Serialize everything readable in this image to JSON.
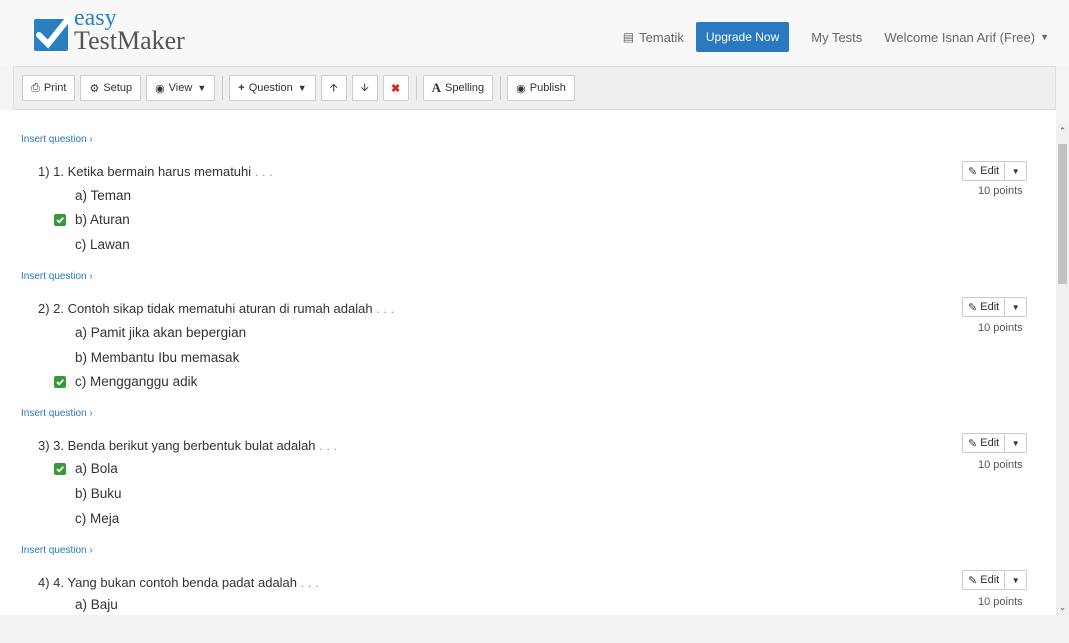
{
  "header": {
    "logo_easy": "easy",
    "logo_testmaker": "TestMaker",
    "tematik": "Tematik",
    "upgrade": "Upgrade Now",
    "my_tests": "My Tests",
    "welcome": "Welcome Isnan Arif (Free)"
  },
  "toolbar": {
    "print": "Print",
    "setup": "Setup",
    "view": "View",
    "question": "Question",
    "spelling": "Spelling",
    "publish": "Publish"
  },
  "insert_label": "Insert question",
  "edit_label": "Edit",
  "questions": [
    {
      "text": "1) 1. Ketika bermain harus mematuhi",
      "dots": ". . .",
      "points": "10 points",
      "options": [
        {
          "label": "a) Teman",
          "correct": false
        },
        {
          "label": "b) Aturan",
          "correct": true
        },
        {
          "label": "c) Lawan",
          "correct": false
        }
      ]
    },
    {
      "text": "2) 2. Contoh sikap tidak mematuhi aturan di rumah adalah",
      "dots": ". . .",
      "points": "10 points",
      "options": [
        {
          "label": "a) Pamit jika akan bepergian",
          "correct": false
        },
        {
          "label": "b) Membantu Ibu memasak",
          "correct": false
        },
        {
          "label": "c) Mengganggu adik",
          "correct": true
        }
      ]
    },
    {
      "text": "3) 3. Benda berikut yang berbentuk bulat adalah",
      "dots": ". . .",
      "points": "10 points",
      "options": [
        {
          "label": "a) Bola",
          "correct": true
        },
        {
          "label": "b) Buku",
          "correct": false
        },
        {
          "label": "c) Meja",
          "correct": false
        }
      ]
    },
    {
      "text": "4) 4. Yang bukan contoh benda padat adalah",
      "dots": ". . .",
      "points": "10 points",
      "options": [
        {
          "label": "a) Baju",
          "correct": false
        }
      ]
    }
  ],
  "colors": {
    "accent": "#2a78bf",
    "check": "#3a9a3a",
    "delete": "#d9291c"
  }
}
